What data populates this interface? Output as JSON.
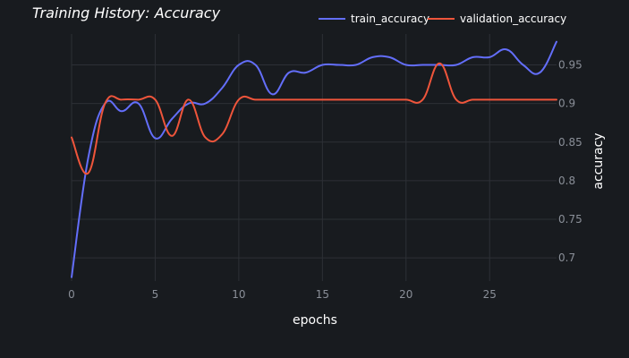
{
  "chart_data": {
    "type": "line",
    "title": "Training History: Accuracy",
    "xlabel": "epochs",
    "ylabel": "accuracy",
    "xlim": [
      0,
      29
    ],
    "ylim": [
      0.67,
      0.99
    ],
    "xticks": [
      0,
      5,
      10,
      15,
      20,
      25
    ],
    "yticks": [
      0.7,
      0.75,
      0.8,
      0.85,
      0.9,
      0.95
    ],
    "ytick_labels": [
      "0.7",
      "0.75",
      "0.8",
      "0.85",
      "0.9",
      "0.95"
    ],
    "grid": true,
    "y_axis_side": "right",
    "legend_position": "top-right",
    "x": [
      0,
      1,
      2,
      3,
      4,
      5,
      6,
      7,
      8,
      9,
      10,
      11,
      12,
      13,
      14,
      15,
      16,
      17,
      18,
      19,
      20,
      21,
      22,
      23,
      24,
      25,
      26,
      27,
      28,
      29
    ],
    "series": [
      {
        "name": "train_accuracy",
        "color": "#636efa",
        "values": [
          0.675,
          0.83,
          0.9,
          0.89,
          0.9,
          0.855,
          0.88,
          0.9,
          0.9,
          0.92,
          0.95,
          0.95,
          0.912,
          0.94,
          0.94,
          0.95,
          0.95,
          0.95,
          0.96,
          0.96,
          0.95,
          0.95,
          0.95,
          0.95,
          0.96,
          0.96,
          0.97,
          0.95,
          0.94,
          0.98
        ]
      },
      {
        "name": "validation_accuracy",
        "color": "#ef553b",
        "values": [
          0.856,
          0.81,
          0.9,
          0.905,
          0.905,
          0.905,
          0.858,
          0.905,
          0.856,
          0.86,
          0.905,
          0.905,
          0.905,
          0.905,
          0.905,
          0.905,
          0.905,
          0.905,
          0.905,
          0.905,
          0.905,
          0.905,
          0.952,
          0.905,
          0.905,
          0.905,
          0.905,
          0.905,
          0.905,
          0.905
        ]
      }
    ]
  }
}
